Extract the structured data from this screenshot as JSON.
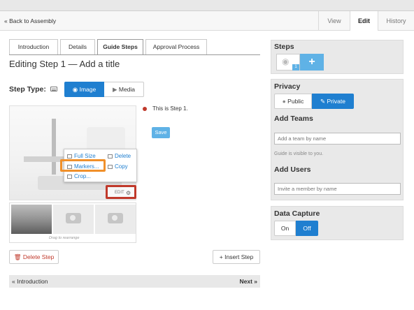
{
  "header": {
    "back_link": "« Back to Assembly",
    "tabs": [
      {
        "label": "View",
        "active": false
      },
      {
        "label": "Edit",
        "active": true
      },
      {
        "label": "History",
        "active": false
      }
    ]
  },
  "guide_tabs": [
    {
      "label": "Introduction",
      "active": false
    },
    {
      "label": "Details",
      "active": false
    },
    {
      "label": "Guide Steps",
      "active": true
    },
    {
      "label": "Approval Process",
      "active": false
    }
  ],
  "page_title": "Editing Step 1 — Add a title",
  "step_type": {
    "label": "Step Type:",
    "image_label": "Image",
    "media_label": "Media",
    "selected": "Image"
  },
  "image_menu": {
    "full_size": "Full Size",
    "markers": "Markers...",
    "crop": "Crop...",
    "delete": "Delete",
    "copy": "Copy",
    "edit": "EDIT"
  },
  "thumbnails_hint": "Drag to rearrange",
  "step_content": {
    "bullet_text": "This is Step 1.",
    "save_label": "Save"
  },
  "actions": {
    "delete_step": "Delete Step",
    "insert_step": "Insert Step"
  },
  "nav": {
    "prev": "« Introduction",
    "next": "Next »"
  },
  "sidebar": {
    "steps": {
      "title": "Steps",
      "badge": "1",
      "add_label": "+"
    },
    "privacy": {
      "title": "Privacy",
      "public_label": "Public",
      "private_label": "Private",
      "selected": "Private"
    },
    "teams": {
      "title": "Add Teams",
      "placeholder": "Add a team by name",
      "hint": "Guide is visible to you."
    },
    "users": {
      "title": "Add Users",
      "placeholder": "Invite a member by name"
    },
    "data_capture": {
      "title": "Data Capture",
      "on_label": "On",
      "off_label": "Off",
      "selected": "Off"
    }
  },
  "colors": {
    "primary": "#1f7fd0",
    "light_blue": "#5fb2e6",
    "danger": "#c0392b",
    "highlight_orange": "#f0902a"
  }
}
